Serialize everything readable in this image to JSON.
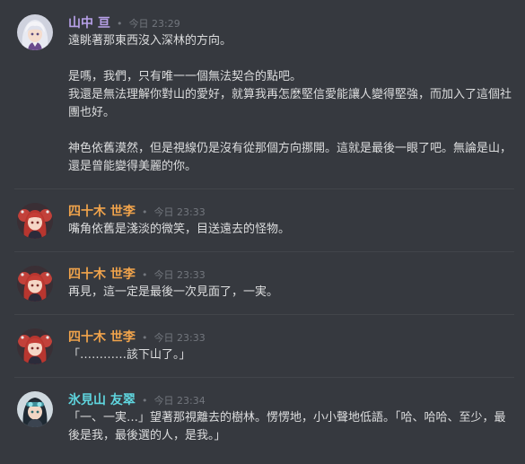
{
  "colors": {
    "background": "#36393f",
    "text": "#dcddde",
    "timestamp": "#72767d",
    "name_lavender": "#b7a0e8",
    "name_orange": "#f0a34b",
    "name_cyan": "#5fd6df"
  },
  "messages": [
    {
      "author": "山中 亘",
      "timestamp": "今日 23:29",
      "avatar_icon": "silver-hair-avatar",
      "lines": [
        "遠眺著那東西沒入深林的方向。",
        "",
        "是嗎，我們，只有唯一一個無法契合的點吧。",
        "我還是無法理解你對山的愛好，就算我再怎麼堅信愛能讓人變得堅強，而加入了這個社團也好。",
        "",
        "神色依舊漠然，但是視線仍是沒有從那個方向挪開。這就是最後一眼了吧。無論是山，還是曾能變得美麗的你。"
      ]
    },
    {
      "author": "四十木 世李",
      "timestamp": "今日 23:33",
      "avatar_icon": "red-twin-tail-avatar",
      "lines": [
        "嘴角依舊是淺淡的微笑，目送遠去的怪物。"
      ]
    },
    {
      "author": "四十木 世李",
      "timestamp": "今日 23:33",
      "avatar_icon": "red-twin-tail-avatar",
      "lines": [
        "再見，這一定是最後一次見面了，一実。"
      ]
    },
    {
      "author": "四十木 世李",
      "timestamp": "今日 23:33",
      "avatar_icon": "red-twin-tail-avatar",
      "lines": [
        "「…………該下山了。」"
      ]
    },
    {
      "author": "氷見山 友翠",
      "timestamp": "今日 23:34",
      "avatar_icon": "dark-hair-goggles-avatar",
      "lines": [
        "「一、一実…」望著那視離去的樹林。愣愣地，小小聲地低語。「哈、哈哈、至少，最後是我，最後選的人，是我。」"
      ]
    }
  ],
  "separator": "•"
}
